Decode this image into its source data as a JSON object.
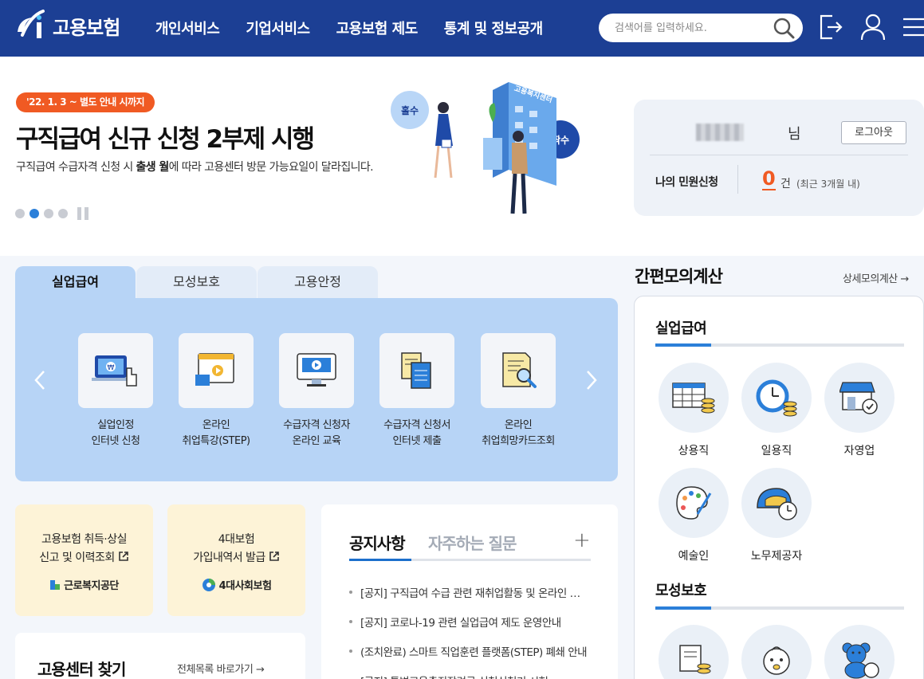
{
  "header": {
    "logo_text": "고용보험",
    "nav": [
      "개인서비스",
      "기업서비스",
      "고용보험 제도",
      "통계 및 정보공개"
    ],
    "search_placeholder": "검색어를 입력하세요."
  },
  "hero": {
    "badge": "'22. 1. 3 ~ 별도 안내 시까지",
    "title": "구직급여 신규 신청 2부제 시행",
    "desc_prefix": "구직급여 수급자격 신청 시 ",
    "desc_bold": "출생 월",
    "desc_suffix": "에 따라 고용센터 방문 가능요일이 달라집니다.",
    "illus_odd": "홀수",
    "illus_even": "짝수",
    "illus_building": "고용복지센터",
    "slides": 4,
    "active_slide": 2
  },
  "user": {
    "suffix": "님",
    "logout": "로그아웃",
    "request_label": "나의 민원신청",
    "request_count": "0",
    "request_unit": "건",
    "request_note": "(최근 3개월 내)"
  },
  "tabs": [
    "실업급여",
    "모성보호",
    "고용안정"
  ],
  "services": [
    {
      "line1": "실업인정",
      "line2": "인터넷 신청"
    },
    {
      "line1": "온라인",
      "line2": "취업특강(STEP)"
    },
    {
      "line1": "수급자격 신청자",
      "line2": "온라인 교육"
    },
    {
      "line1": "수급자격 신청서",
      "line2": "인터넷 제출"
    },
    {
      "line1": "온라인",
      "line2": "취업희망카드조회"
    }
  ],
  "quick": [
    {
      "line1": "고용보험 취득·상실",
      "line2": "신고 및 이력조회",
      "org": "근로복지공단"
    },
    {
      "line1": "4대보험",
      "line2": "가입내역서 발급",
      "org": "4대사회보험"
    }
  ],
  "center": {
    "title": "고용센터 찾기",
    "link": "전체목록 바로가기"
  },
  "notice": {
    "tab_active": "공지사항",
    "tab_inactive": "자주하는 질문",
    "items": [
      "[공지] 구직급여 수급 관련 재취업활동 및 온라인 교육 안내",
      "[공지] 코로나-19 관련 실업급여 제도 운영안내",
      "(조치완료) 스마트 직업훈련 플랫폼(STEP) 폐쇄 안내",
      "[공지] 통변고용촉진장려금 신청신청기 시험"
    ]
  },
  "calc": {
    "title": "간편모의계산",
    "link": "상세모의계산",
    "sec1": "실업급여",
    "sec1_items": [
      "상용직",
      "일용직",
      "자영업",
      "예술인",
      "노무제공자"
    ],
    "sec2": "모성보호"
  }
}
